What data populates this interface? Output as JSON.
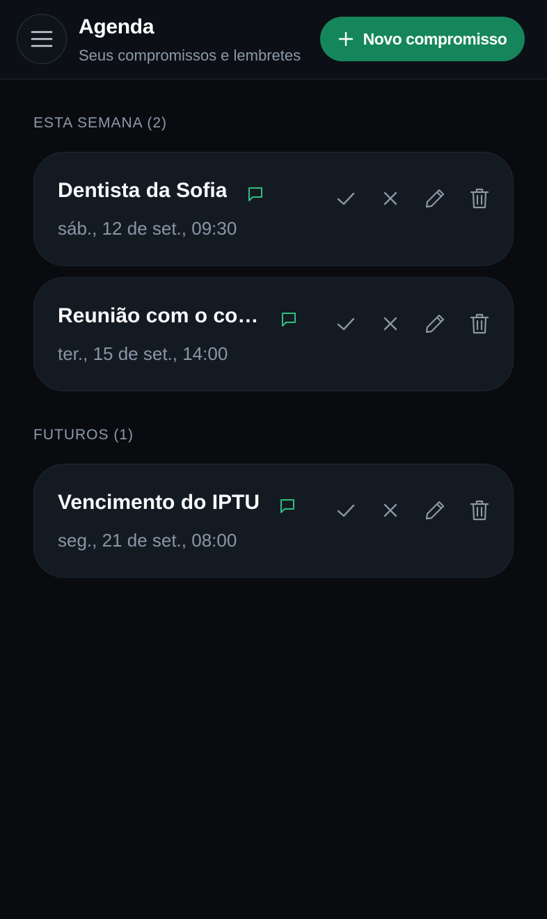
{
  "header": {
    "title": "Agenda",
    "subtitle": "Seus compromissos e lembretes",
    "new_button_label": "Novo compromisso",
    "menu_icon": "hamburger-menu-icon"
  },
  "sections": [
    {
      "label": "ESTA SEMANA (2)",
      "items": [
        {
          "title": "Dentista da Sofia",
          "date": "sáb., 12 de set., 09:30"
        },
        {
          "title": "Reunião com o con…",
          "date": "ter., 15 de set., 14:00"
        }
      ]
    },
    {
      "label": "FUTUROS (1)",
      "items": [
        {
          "title": "Vencimento do IPTU",
          "date": "seg., 21 de set., 08:00"
        }
      ]
    }
  ],
  "icons": {
    "note": "chat-bubble-icon",
    "done": "check-icon",
    "cancel": "close-icon",
    "edit": "pencil-icon",
    "delete": "trash-icon"
  },
  "colors": {
    "background": "#090b0f",
    "card": "#141a22",
    "accent": "#15865b",
    "note_icon": "#2fbf7f"
  }
}
